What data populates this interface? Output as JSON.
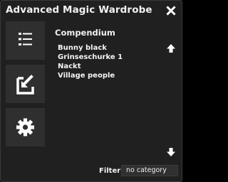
{
  "window": {
    "title": "Advanced Magic Wardrobe"
  },
  "sidebar": {
    "buttons": [
      {
        "icon": "list-icon"
      },
      {
        "icon": "export-icon"
      },
      {
        "icon": "gear-icon"
      }
    ]
  },
  "main": {
    "section_title": "Compendium",
    "items": [
      "Bunny black",
      "Grinseschurke 1",
      "Nackt",
      "Village people"
    ]
  },
  "filter": {
    "label": "Filter",
    "value": "no category"
  },
  "colors": {
    "window_bg": "#202020",
    "button_bg": "#2f2f2f",
    "text": "#ffffff"
  }
}
